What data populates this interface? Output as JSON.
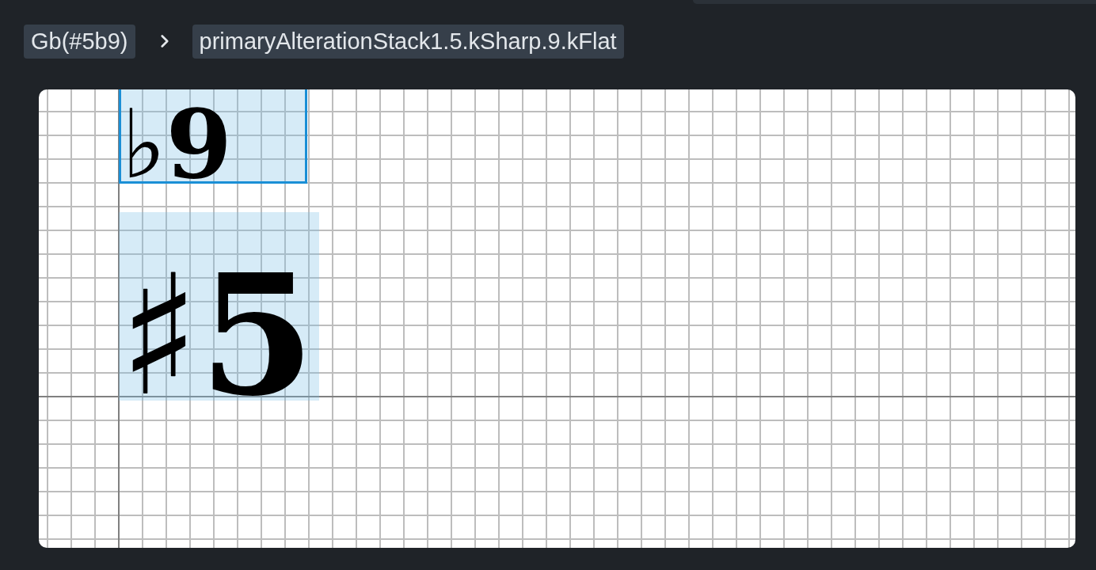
{
  "breadcrumb": [
    {
      "label": "Gb(#5b9)"
    },
    {
      "label": "primaryAlterationStack1.5.kSharp.9.kFlat"
    }
  ],
  "glyphs": [
    {
      "text": "♭9",
      "selected": true
    },
    {
      "text": "♯5",
      "selected": false
    }
  ]
}
